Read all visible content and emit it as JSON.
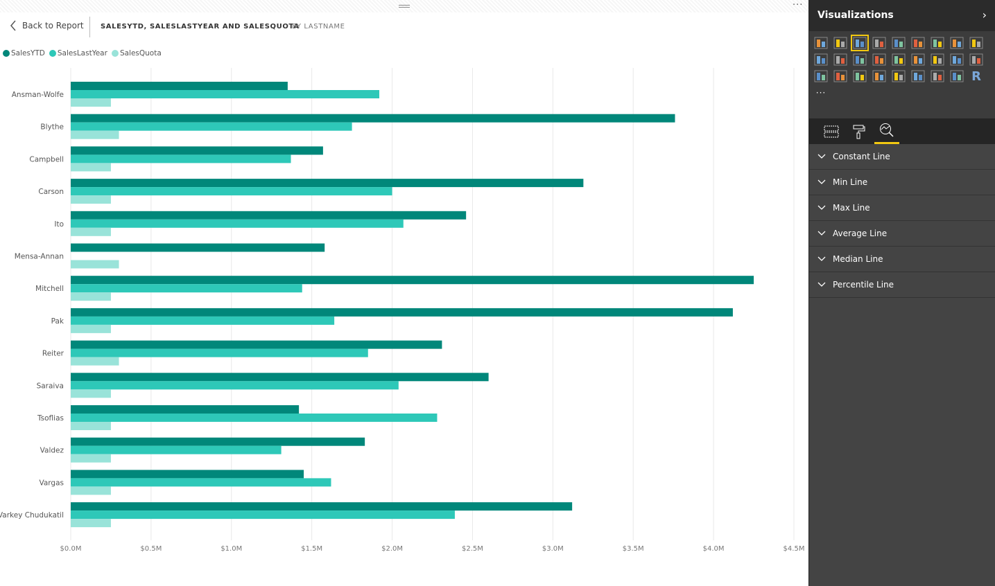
{
  "header": {
    "back_label": "Back to Report",
    "title": "SALESYTD, SALESLASTYEAR AND SALESQUOTA",
    "subtitle": "BY LASTNAME",
    "more": "···"
  },
  "colors": {
    "SalesYTD": "#01877a",
    "SalesLastYear": "#2ec8b8",
    "SalesQuota": "#99e3d9",
    "accent": "#f2c811"
  },
  "chart_data": {
    "type": "bar",
    "orientation": "horizontal",
    "title": "SALESYTD, SALESLASTYEAR AND SALESQUOTA",
    "subtitle": "BY LASTNAME",
    "categories": [
      "Ansman-Wolfe",
      "Blythe",
      "Campbell",
      "Carson",
      "Ito",
      "Mensa-Annan",
      "Mitchell",
      "Pak",
      "Reiter",
      "Saraiva",
      "Tsoflias",
      "Valdez",
      "Vargas",
      "Varkey Chudukatil"
    ],
    "series": [
      {
        "name": "SalesYTD",
        "color": "#01877a",
        "values": [
          1.35,
          3.76,
          1.57,
          3.19,
          2.46,
          1.58,
          4.25,
          4.12,
          2.31,
          2.6,
          1.42,
          1.83,
          1.45,
          3.12
        ]
      },
      {
        "name": "SalesLastYear",
        "color": "#2ec8b8",
        "values": [
          1.92,
          1.75,
          1.37,
          2.0,
          2.07,
          0,
          1.44,
          1.64,
          1.85,
          2.04,
          2.28,
          1.31,
          1.62,
          2.39
        ]
      },
      {
        "name": "SalesQuota",
        "color": "#99e3d9",
        "values": [
          0.25,
          0.3,
          0.25,
          0.25,
          0.25,
          0.3,
          0.25,
          0.25,
          0.3,
          0.25,
          0.25,
          0.25,
          0.25,
          0.25
        ]
      }
    ],
    "units": "millions USD",
    "xlim": [
      0,
      4.5
    ],
    "xticks": [
      "$0.0M",
      "$0.5M",
      "$1.0M",
      "$1.5M",
      "$2.0M",
      "$2.5M",
      "$3.0M",
      "$3.5M",
      "$4.0M",
      "$4.5M"
    ],
    "grid": true,
    "legend": "top-left"
  },
  "panel": {
    "title": "Visualizations",
    "viz_icons": [
      "stacked-bar",
      "stacked-column",
      "clustered-bar",
      "clustered-column",
      "100-stacked-bar",
      "100-stacked-column",
      "line",
      "area",
      "stacked-area",
      "line-stacked-column",
      "line-clustered-column",
      "ribbon",
      "scatter",
      "pie",
      "treemap",
      "map",
      "table",
      "matrix",
      "filled-map",
      "funnel",
      "gauge",
      "multirow-card",
      "card",
      "kpi",
      "slicer",
      "donut",
      "r-script",
      "more"
    ],
    "selected_viz": "clustered-bar",
    "tabs": [
      "fields",
      "format",
      "analytics"
    ],
    "active_tab": "analytics",
    "items": [
      "Constant Line",
      "Min Line",
      "Max Line",
      "Average Line",
      "Median Line",
      "Percentile Line"
    ]
  }
}
